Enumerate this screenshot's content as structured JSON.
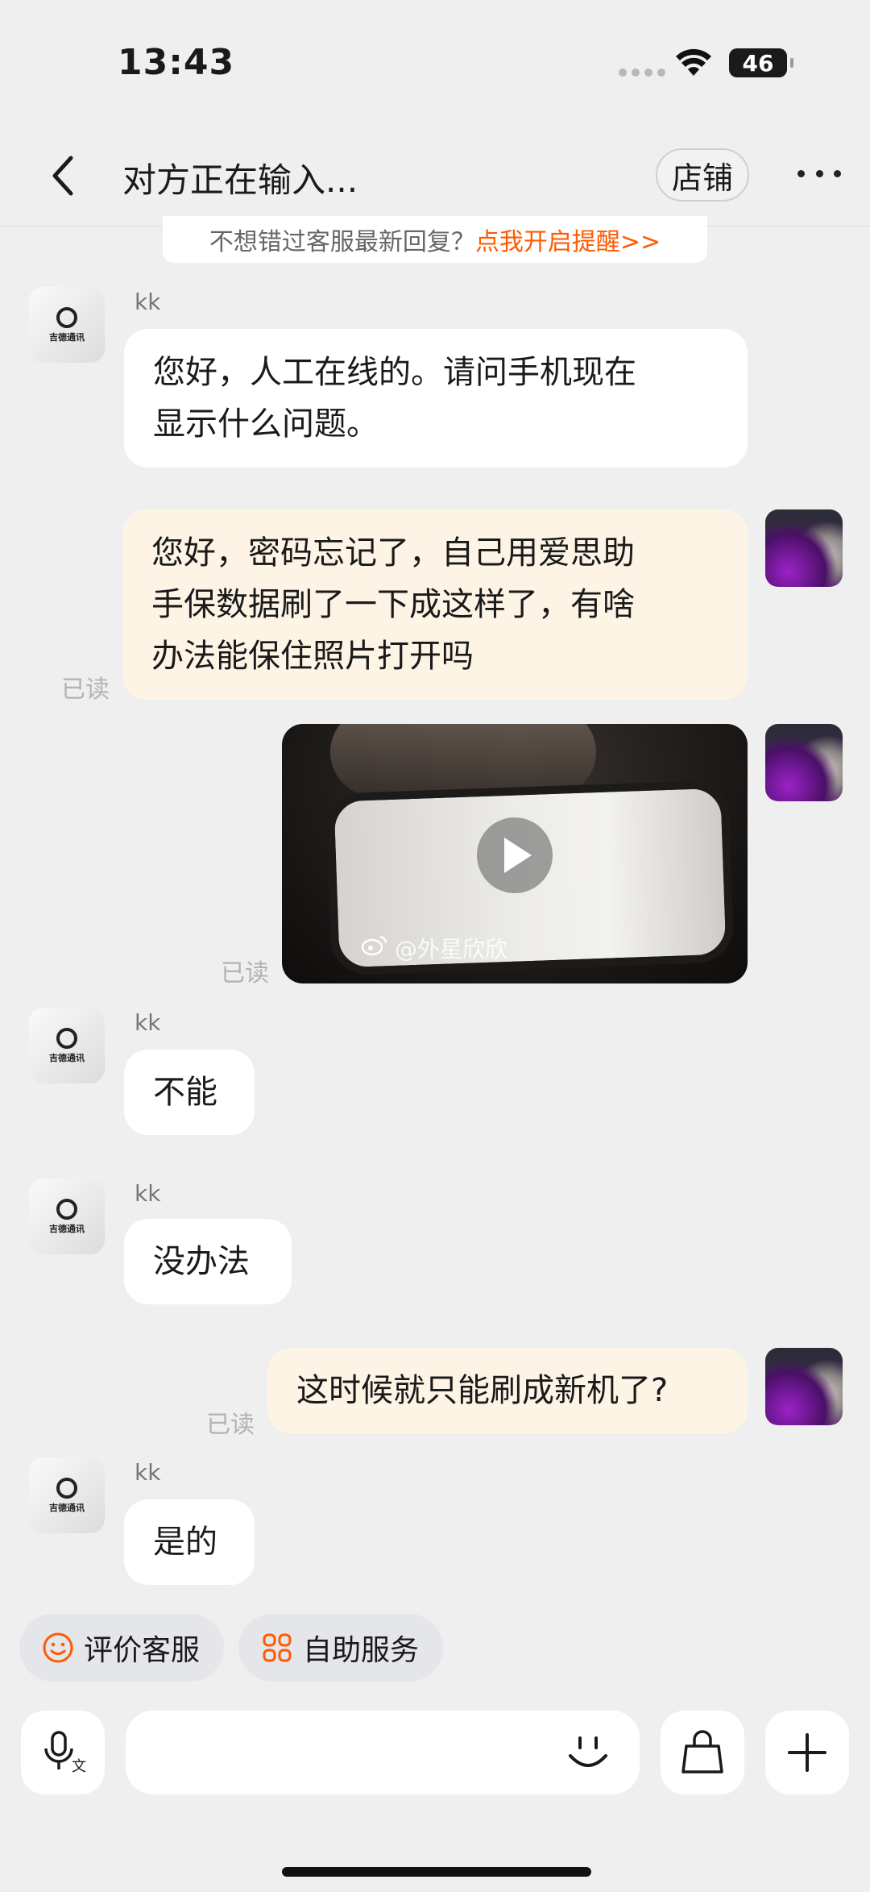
{
  "status_bar": {
    "time": "13:43",
    "battery": "46"
  },
  "header": {
    "title": "对方正在输入...",
    "store_label": "店铺"
  },
  "notice": {
    "text": "不想错过客服最新回复？",
    "link": "点我开启提醒>>"
  },
  "messages": [
    {
      "from": "kk",
      "sender": "kk",
      "text_lines": [
        "您好，人工在线的。请问手机现在",
        "显示什么问题。"
      ]
    },
    {
      "from": "me",
      "text_lines": [
        "您好，密码忘记了，自己用爱思助",
        "手保数据刷了一下成这样了，有啥",
        "办法能保住照片打开吗"
      ],
      "read": "已读"
    },
    {
      "from": "me",
      "type": "video",
      "watermark": "@外星欣欣",
      "read": "已读"
    },
    {
      "from": "kk",
      "sender": "kk",
      "text": "不能"
    },
    {
      "from": "kk",
      "sender": "kk",
      "text": "没办法"
    },
    {
      "from": "me",
      "text": "这时候就只能刷成新机了?",
      "read": "已读"
    },
    {
      "from": "kk",
      "sender": "kk",
      "text": "是的"
    }
  ],
  "quick_actions": [
    {
      "label": "评价客服",
      "icon": "smile-icon"
    },
    {
      "label": "自助服务",
      "icon": "grid-icon"
    }
  ],
  "input_bar": {
    "voice_icon": "mic-icon",
    "emoji_icon": "emoji-icon",
    "shop_icon": "shopping-bag-icon",
    "more_icon": "plus-icon"
  },
  "colors": {
    "accent": "#ff5a00",
    "outgoing_bubble": "#fdf4e6",
    "incoming_bubble": "#ffffff",
    "background": "#efefef"
  }
}
